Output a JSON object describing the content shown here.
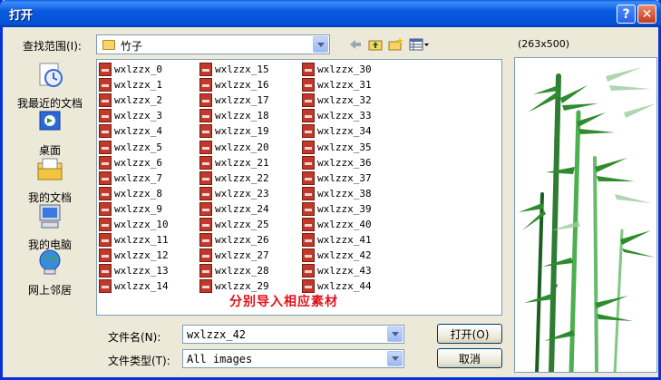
{
  "window": {
    "title": "打开"
  },
  "titlebar_buttons": {
    "help": "?",
    "close": "✕"
  },
  "look_in": {
    "label": "查找范围(I):",
    "value": "竹子"
  },
  "places": [
    {
      "label": "我最近的文档",
      "icon": "recent-documents-icon"
    },
    {
      "label": "桌面",
      "icon": "desktop-icon"
    },
    {
      "label": "我的文档",
      "icon": "my-documents-icon"
    },
    {
      "label": "我的电脑",
      "icon": "my-computer-icon"
    },
    {
      "label": "网上邻居",
      "icon": "network-places-icon"
    }
  ],
  "files": {
    "col1": [
      "wxlzzx_0",
      "wxlzzx_1",
      "wxlzzx_2",
      "wxlzzx_3",
      "wxlzzx_4",
      "wxlzzx_5",
      "wxlzzx_6",
      "wxlzzx_7",
      "wxlzzx_8",
      "wxlzzx_9",
      "wxlzzx_10",
      "wxlzzx_11",
      "wxlzzx_12",
      "wxlzzx_13",
      "wxlzzx_14"
    ],
    "col2": [
      "wxlzzx_15",
      "wxlzzx_16",
      "wxlzzx_17",
      "wxlzzx_18",
      "wxlzzx_19",
      "wxlzzx_20",
      "wxlzzx_21",
      "wxlzzx_22",
      "wxlzzx_23",
      "wxlzzx_24",
      "wxlzzx_25",
      "wxlzzx_26",
      "wxlzzx_27",
      "wxlzzx_28",
      "wxlzzx_29"
    ],
    "col3": [
      "wxlzzx_30",
      "wxlzzx_31",
      "wxlzzx_32",
      "wxlzzx_33",
      "wxlzzx_34",
      "wxlzzx_35",
      "wxlzzx_36",
      "wxlzzx_37",
      "wxlzzx_38",
      "wxlzzx_39",
      "wxlzzx_40",
      "wxlzzx_41",
      "wxlzzx_42",
      "wxlzzx_43",
      "wxlzzx_44"
    ]
  },
  "overlay_note": "分别导入相应素材",
  "file_name": {
    "label": "文件名(N):",
    "value": "wxlzzx_42"
  },
  "file_type": {
    "label": "文件类型(T):",
    "value": "All images"
  },
  "buttons": {
    "open": "打开(O)",
    "cancel": "取消"
  },
  "preview": {
    "size": "(263x500)"
  },
  "colors": {
    "titlebar": "#0a5ae0",
    "dialog_bg": "#ece9d8",
    "overlay_text": "#e0101a",
    "bamboo": "#2e8b2e"
  }
}
